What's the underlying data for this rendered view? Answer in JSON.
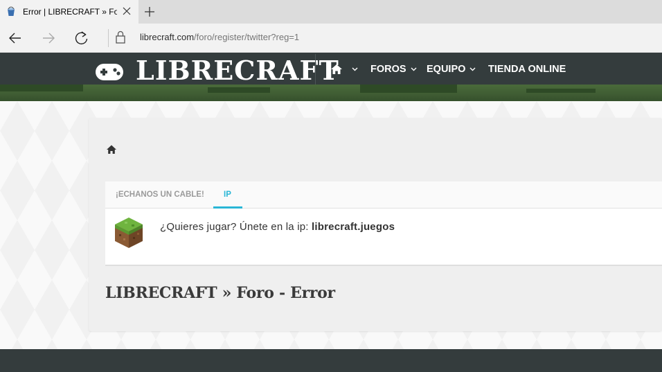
{
  "browser": {
    "tab_title": "Error | LIBRECRAFT » Fo",
    "url_domain": "librecraft.com",
    "url_path": "/foro/register/twitter?reg=1"
  },
  "site": {
    "logo_text": "LIBRECRAFT",
    "menu": {
      "foros": "FOROS",
      "equipo": "EQUIPO",
      "tienda": "TIENDA ONLINE"
    }
  },
  "notice": {
    "tabs": [
      "¡ECHANOS UN CABLE!",
      "IP"
    ],
    "text_prefix": "¿Quieres jugar? Únete en la ip: ",
    "ip": "librecraft.juegos"
  },
  "page": {
    "title": "LIBRECRAFT » Foro - Error"
  },
  "colors": {
    "header": "#343c3d",
    "accent": "#29b6d6"
  }
}
